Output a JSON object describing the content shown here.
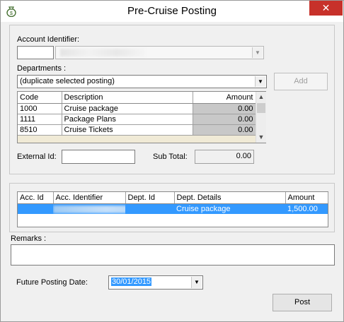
{
  "window": {
    "title": "Pre-Cruise Posting",
    "close_glyph": "✕",
    "icon": "money-bag-icon"
  },
  "account": {
    "label": "Account Identifier:"
  },
  "departments": {
    "label": "Departments :",
    "selected": "(duplicate selected posting)",
    "add_label": "Add"
  },
  "dept_grid": {
    "headers": [
      "Code",
      "Description",
      "Amount"
    ],
    "rows": [
      {
        "code": "1000",
        "description": "Cruise package",
        "amount": "0.00"
      },
      {
        "code": "1111",
        "description": "Package Plans",
        "amount": "0.00"
      },
      {
        "code": "8510",
        "description": "Cruise Tickets",
        "amount": "0.00"
      }
    ]
  },
  "external_id": {
    "label": "External Id:",
    "value": ""
  },
  "subtotal": {
    "label": "Sub Total:",
    "value": "0.00"
  },
  "postings": {
    "headers": [
      "Acc. Id",
      "Acc. Identifier",
      "Dept. Id",
      "Dept. Details",
      "Amount"
    ],
    "rows": [
      {
        "acc_id": "",
        "acc_identifier": "",
        "dept_id": "",
        "dept_details": "Cruise package",
        "amount": "1,500.00"
      }
    ]
  },
  "remarks": {
    "label": "Remarks :",
    "value": ""
  },
  "future_date": {
    "label": "Future Posting Date:",
    "value": "30/01/2015"
  },
  "post_label": "Post",
  "colors": {
    "selection": "#3399ff",
    "close": "#c7312a"
  }
}
